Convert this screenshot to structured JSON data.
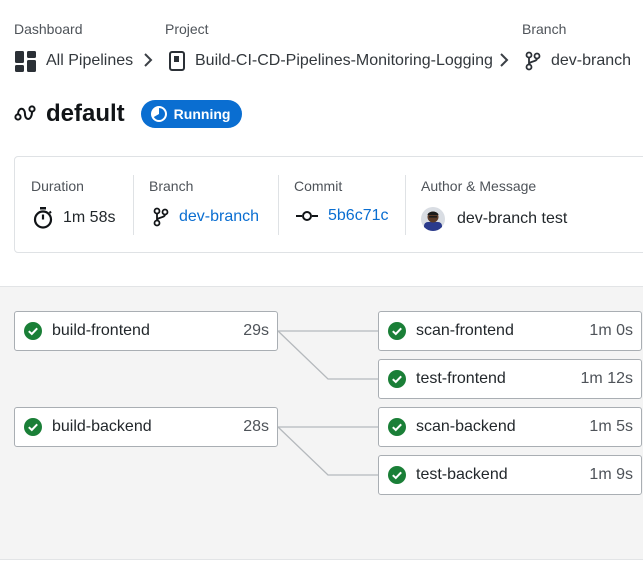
{
  "breadcrumb": {
    "dashboard": {
      "heading": "Dashboard",
      "label": "All Pipelines"
    },
    "project": {
      "heading": "Project",
      "label": "Build-CI-CD-Pipelines-Monitoring-Logging"
    },
    "branch": {
      "heading": "Branch",
      "label": "dev-branch"
    }
  },
  "pipeline": {
    "name": "default",
    "status": "Running"
  },
  "summary": {
    "duration": {
      "label": "Duration",
      "value": "1m 58s"
    },
    "branch": {
      "label": "Branch",
      "value": "dev-branch"
    },
    "commit": {
      "label": "Commit",
      "value": "5b6c71c"
    },
    "author": {
      "label": "Author & Message",
      "message": "dev-branch test"
    }
  },
  "jobs": {
    "build_frontend": {
      "name": "build-frontend",
      "duration": "29s",
      "status": "success"
    },
    "build_backend": {
      "name": "build-backend",
      "duration": "28s",
      "status": "success"
    },
    "scan_frontend": {
      "name": "scan-frontend",
      "duration": "1m 0s",
      "status": "success"
    },
    "test_frontend": {
      "name": "test-frontend",
      "duration": "1m 12s",
      "status": "success"
    },
    "scan_backend": {
      "name": "scan-backend",
      "duration": "1m 5s",
      "status": "success"
    },
    "test_backend": {
      "name": "test-backend",
      "duration": "1m 9s",
      "status": "success"
    }
  },
  "colors": {
    "accent": "#0a6ed1",
    "success": "#1a7f37",
    "text": "#22272b"
  }
}
